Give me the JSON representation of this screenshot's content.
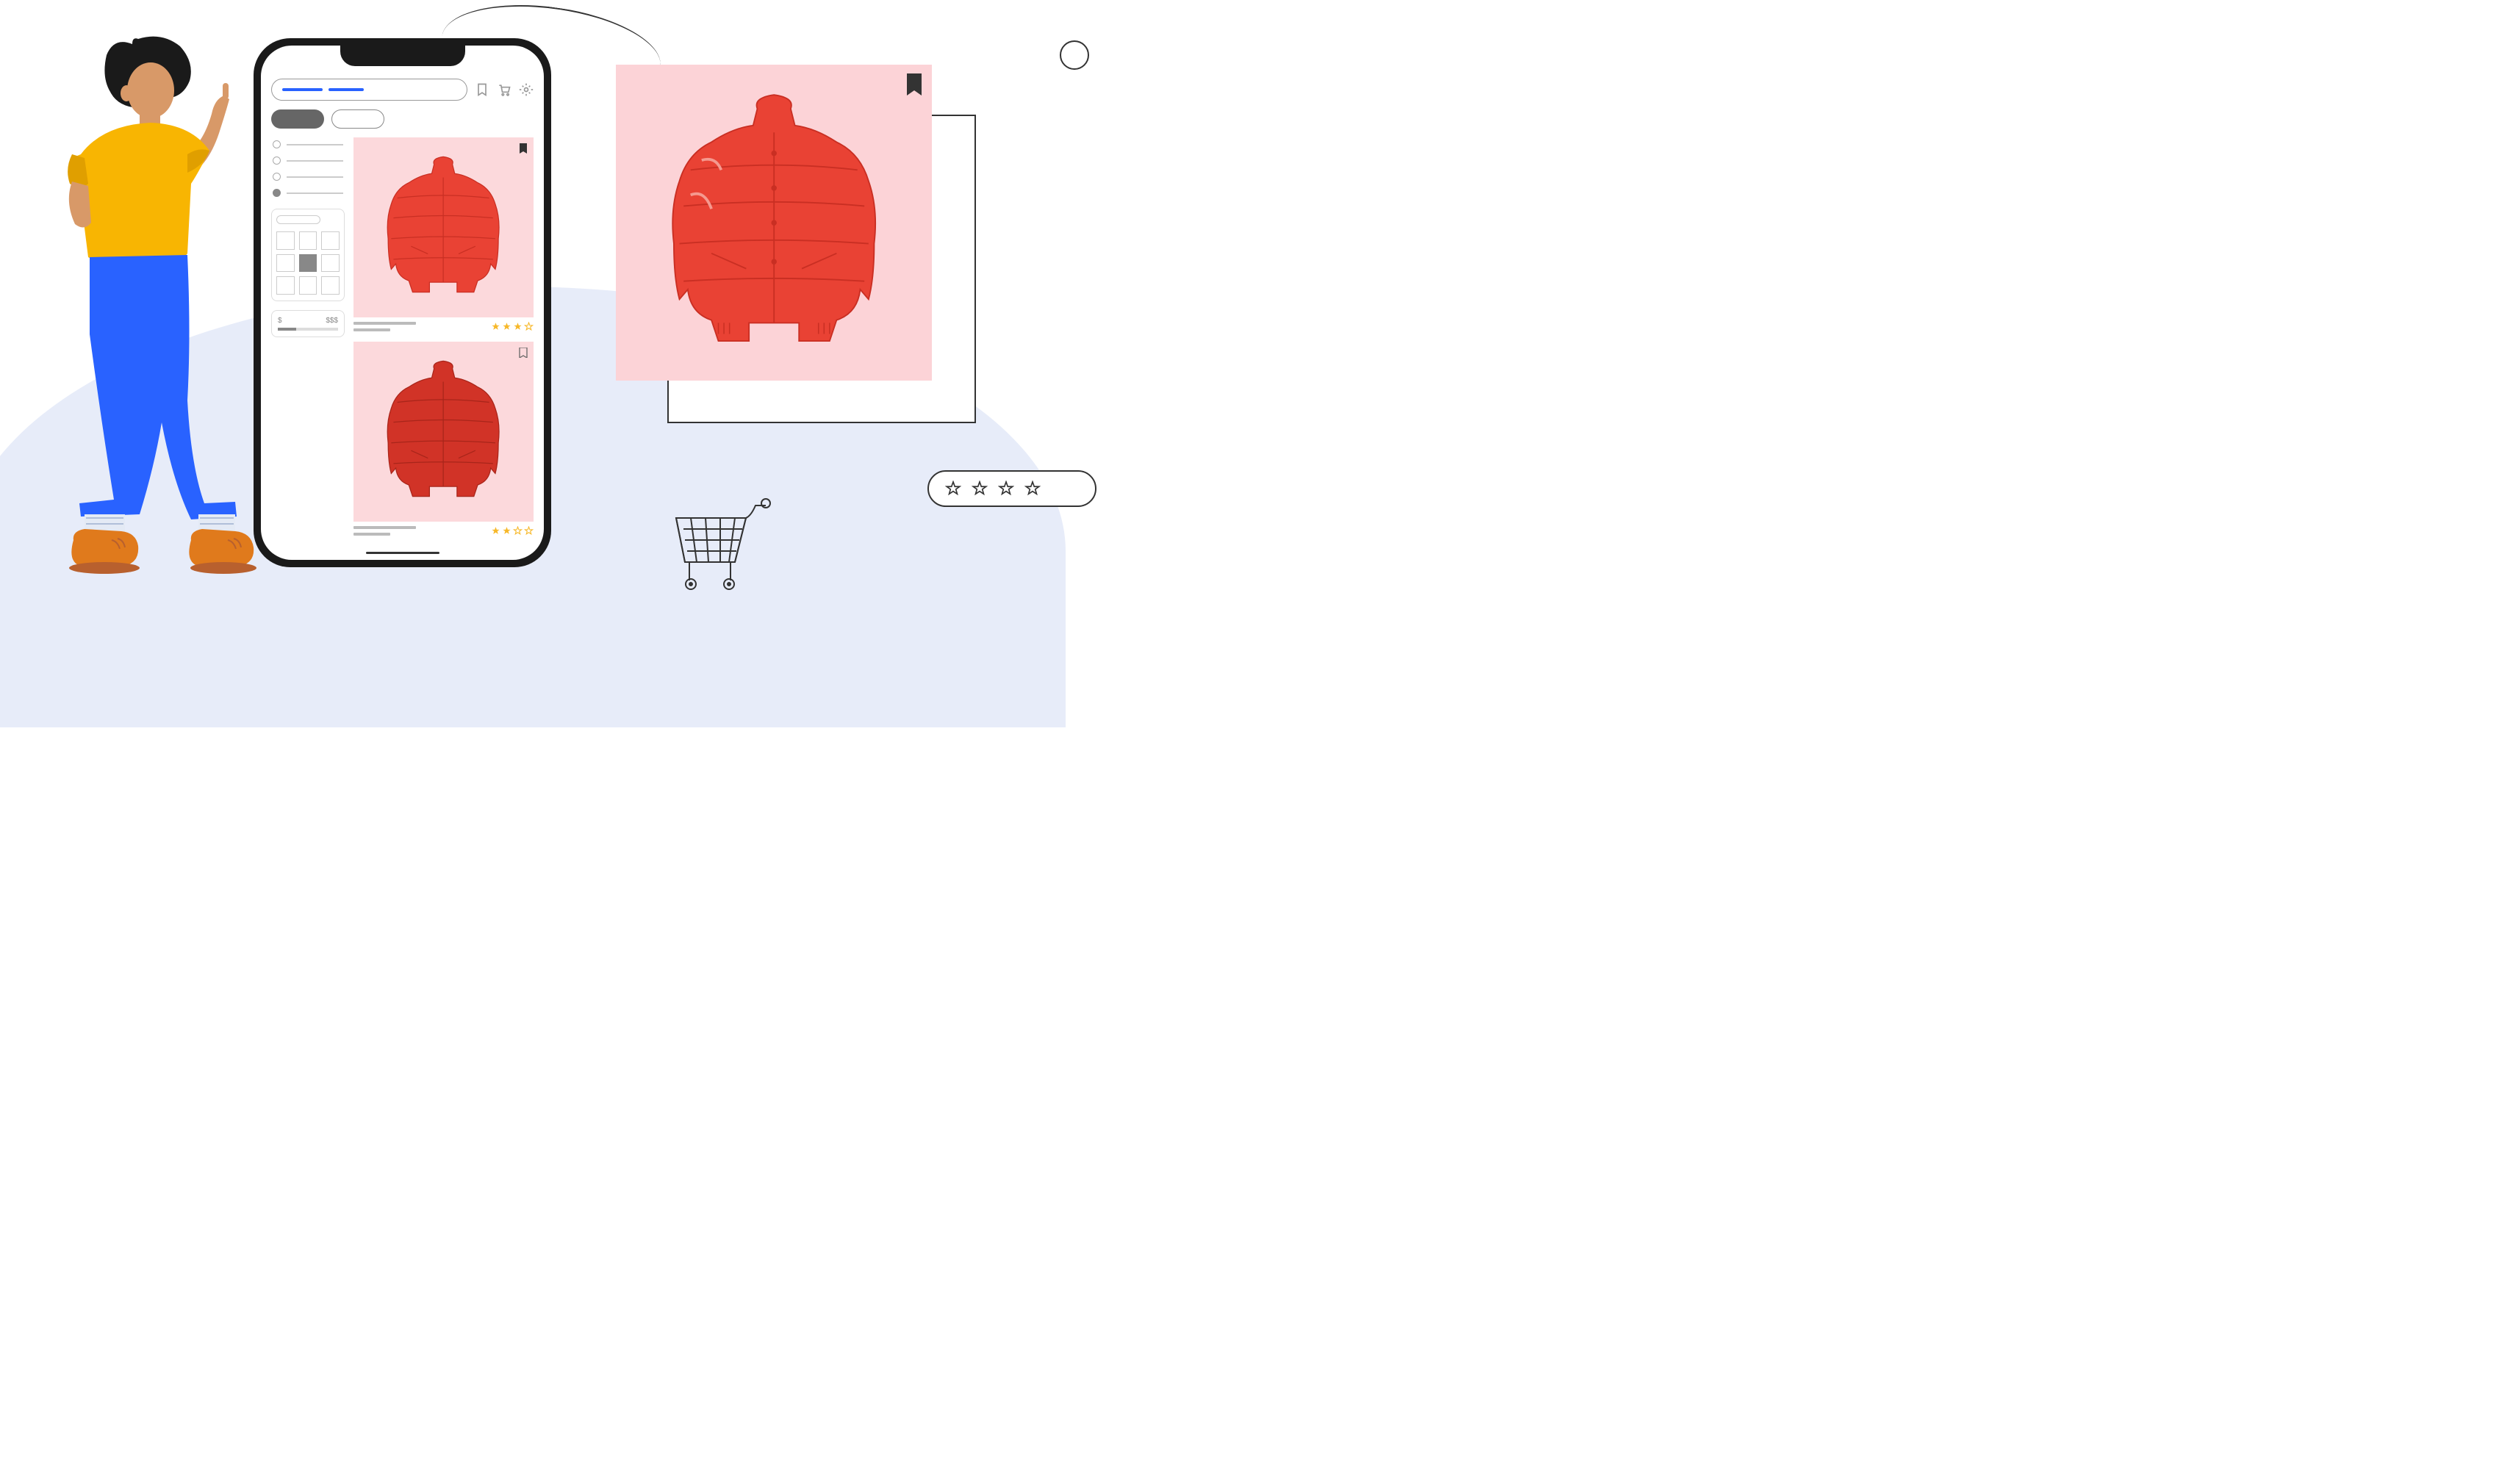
{
  "phone": {
    "filters": {
      "price_low": "$",
      "price_high": "$$$",
      "grid_selected_index": 4,
      "radio_selected_index": 3
    },
    "products": [
      {
        "rating_filled": 3,
        "rating_total": 4,
        "bookmarked": true
      },
      {
        "rating_filled": 2,
        "rating_total": 4,
        "bookmarked": false
      }
    ]
  },
  "large_product": {
    "bookmarked": true
  },
  "rating_widget": {
    "stars_shown": 4
  },
  "colors": {
    "accent": "#2962ff",
    "jacket": "#e94234",
    "jacket_dark": "#c92f23",
    "product_bg": "#fcd9dc",
    "star_fill": "#f7b829"
  }
}
